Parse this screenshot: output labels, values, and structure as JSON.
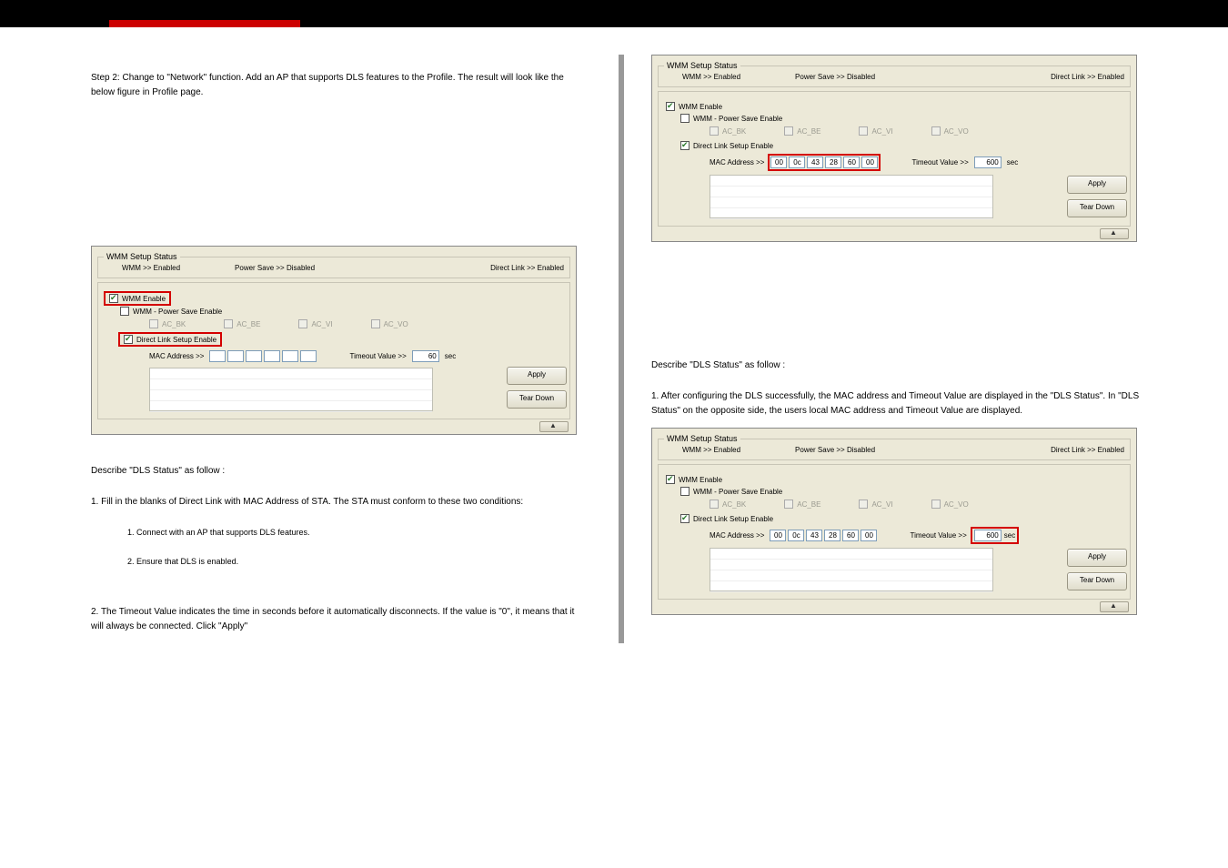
{
  "left": {
    "step2": "Step 2: Change to \"Network\" function. Add an AP that supports DLS features to the Profile. The result will look like the below figure in Profile page.",
    "panel": {
      "legend": "WMM Setup Status",
      "status": {
        "wmm": "WMM >> Enabled",
        "ps": "Power Save >> Disabled",
        "dl": "Direct Link >> Enabled"
      },
      "wmm_enable": "WMM Enable",
      "ps_enable": "WMM - Power Save Enable",
      "ac": {
        "bk": "AC_BK",
        "be": "AC_BE",
        "vi": "AC_VI",
        "vo": "AC_VO"
      },
      "dls_enable": "Direct Link Setup Enable",
      "mac_label": "MAC Address >>",
      "mac": [
        "",
        "",
        "",
        "",
        "",
        ""
      ],
      "timeout_label": "Timeout Value >>",
      "timeout": "60",
      "sec": "sec",
      "apply": "Apply",
      "tear": "Tear Down"
    },
    "describe_heading": "Describe \"DLS Status\" as follow :",
    "d1": "1. Fill in the blanks of Direct Link with MAC Address of STA. The STA must conform to these two conditions:",
    "d1a": "1. Connect with an AP that supports DLS features.",
    "d1b": "2. Ensure that DLS is enabled.",
    "d2": "2. The Timeout Value indicates the time in seconds before it automatically disconnects. If the value is \"0\", it means that it will always be connected. Click \"Apply\""
  },
  "right": {
    "panelA": {
      "mac": [
        "00",
        "0c",
        "43",
        "28",
        "60",
        "00"
      ],
      "timeout": "600"
    },
    "panelB": {
      "mac": [
        "00",
        "0c",
        "43",
        "28",
        "60",
        "00"
      ],
      "timeout": "600"
    },
    "heading": "Describe \"DLS Status\" as follow :",
    "t1": "1. After configuring the DLS successfully, the MAC address and Timeout Value are displayed in the \"DLS Status\". In \"DLS Status\" on the opposite side, the users local MAC address and Timeout Value are displayed."
  },
  "shared": {
    "legend": "WMM Setup Status",
    "status": {
      "wmm": "WMM >> Enabled",
      "ps": "Power Save >> Disabled",
      "dl": "Direct Link >> Enabled"
    },
    "wmm_enable": "WMM Enable",
    "ps_enable": "WMM - Power Save Enable",
    "ac": {
      "bk": "AC_BK",
      "be": "AC_BE",
      "vi": "AC_VI",
      "vo": "AC_VO"
    },
    "dls_enable": "Direct Link Setup Enable",
    "mac_label": "MAC Address >>",
    "timeout_label": "Timeout Value >>",
    "sec": "sec",
    "apply": "Apply",
    "tear": "Tear Down"
  }
}
